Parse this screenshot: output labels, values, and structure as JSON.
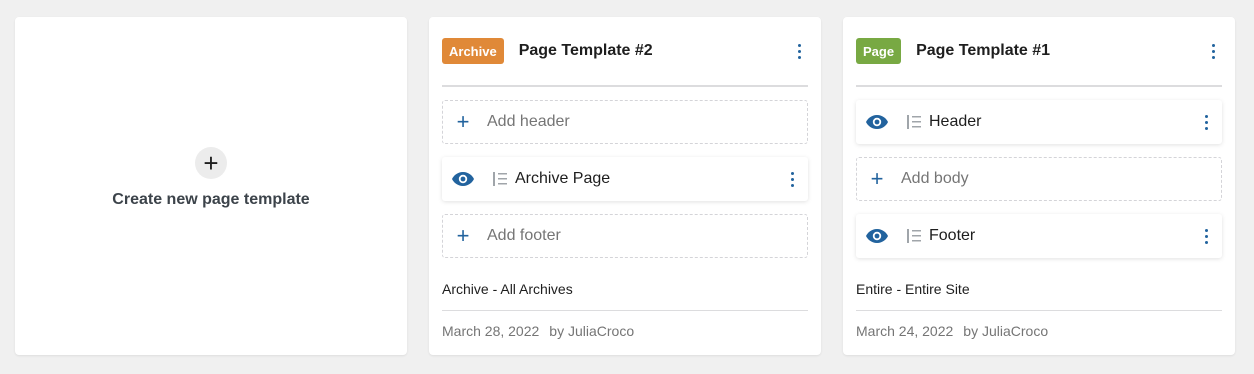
{
  "create": {
    "icon": "plus-icon",
    "plus_glyph": "+",
    "label": "Create new page template"
  },
  "templates": [
    {
      "badge": "Archive",
      "badge_color": "#e08938",
      "title": "Page Template #2",
      "slots": [
        {
          "type": "empty",
          "label": "Add header"
        },
        {
          "type": "filled",
          "label": "Archive Page"
        },
        {
          "type": "empty",
          "label": "Add footer"
        }
      ],
      "condition": "Archive - All Archives",
      "date": "March 28, 2022",
      "author": "by JuliaCroco"
    },
    {
      "badge": "Page",
      "badge_color": "#78a943",
      "title": "Page Template #1",
      "slots": [
        {
          "type": "filled",
          "label": "Header"
        },
        {
          "type": "empty",
          "label": "Add body"
        },
        {
          "type": "filled",
          "label": "Footer"
        }
      ],
      "condition": "Entire - Entire Site",
      "date": "March 24, 2022",
      "author": "by JuliaCroco"
    }
  ],
  "glyphs": {
    "add": "+"
  },
  "colors": {
    "accent": "#22639e",
    "archive_badge": "#e08938",
    "page_badge": "#78a943"
  }
}
